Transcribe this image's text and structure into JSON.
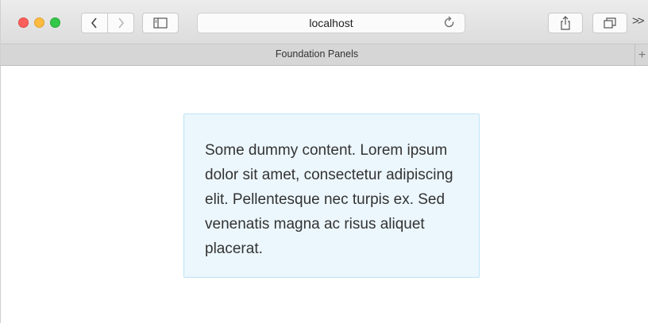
{
  "browser": {
    "url": "localhost",
    "tab_title": "Foundation Panels",
    "colors": {
      "close": "#fc605c",
      "minimize": "#fdbc40",
      "maximize": "#34c84a"
    },
    "icons": [
      "chevron-left-icon",
      "chevron-right-icon",
      "sidebar-icon",
      "reload-icon",
      "share-icon",
      "tabs-overview-icon",
      "chevron-double-right-icon",
      "plus-icon"
    ]
  },
  "panel": {
    "text": "Some dummy content. Lorem ipsum dolor sit amet, consectetur adipiscing elit. Pellentesque nec turpis ex. Sed venenatis magna ac risus aliquet placerat.",
    "background": "#ecf7fd",
    "border": "#bde3f5"
  }
}
